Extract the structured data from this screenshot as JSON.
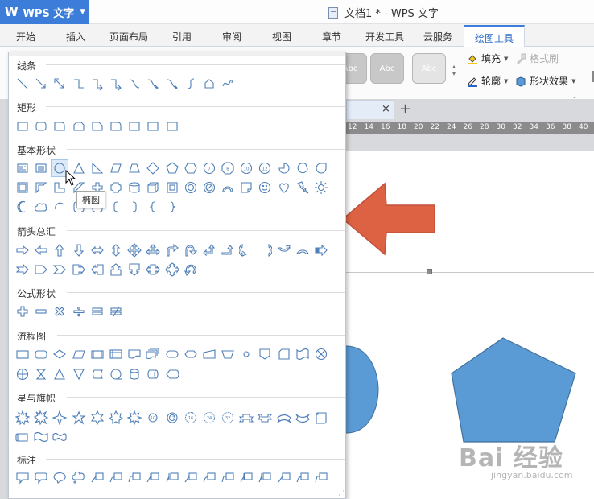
{
  "app": {
    "logo": "W",
    "name": "WPS 文字"
  },
  "window": {
    "title": "文档1 * - WPS 文字"
  },
  "tabs": [
    {
      "label": "开始"
    },
    {
      "label": "插入"
    },
    {
      "label": "页面布局"
    },
    {
      "label": "引用"
    },
    {
      "label": "审阅"
    },
    {
      "label": "视图"
    },
    {
      "label": "章节"
    },
    {
      "label": "开发工具"
    },
    {
      "label": "云服务"
    },
    {
      "label": "绘图工具",
      "active": true
    }
  ],
  "ribbon": {
    "style_preview": [
      "Abc",
      "Abc",
      "Abc"
    ],
    "fill_label": "填充",
    "format_painter_label": "格式刷",
    "outline_label": "轮廓",
    "shape_effect_label": "形状效果"
  },
  "document": {
    "tab_close": "×",
    "tab_add": "+",
    "ruler_ticks": [
      "12",
      "14",
      "16",
      "18",
      "20",
      "22",
      "24",
      "26",
      "28",
      "30",
      "32",
      "34",
      "36",
      "38",
      "40"
    ],
    "watermark_main": "Bai 经验",
    "watermark_sub": "jingyan.baidu.com",
    "colors": {
      "arrow": "#dd6244",
      "shape_fill": "#5b9bd5",
      "shape_stroke": "#41719c"
    }
  },
  "shape_panel": {
    "categories": [
      {
        "key": "lines",
        "title": "线条"
      },
      {
        "key": "rects",
        "title": "矩形"
      },
      {
        "key": "basic",
        "title": "基本形状"
      },
      {
        "key": "arrows",
        "title": "箭头总汇"
      },
      {
        "key": "formula",
        "title": "公式形状"
      },
      {
        "key": "flow",
        "title": "流程图"
      },
      {
        "key": "stars",
        "title": "星与旗帜"
      },
      {
        "key": "callouts",
        "title": "标注"
      }
    ],
    "tooltip": "椭圆",
    "icon_color": "#4f7fb6"
  }
}
